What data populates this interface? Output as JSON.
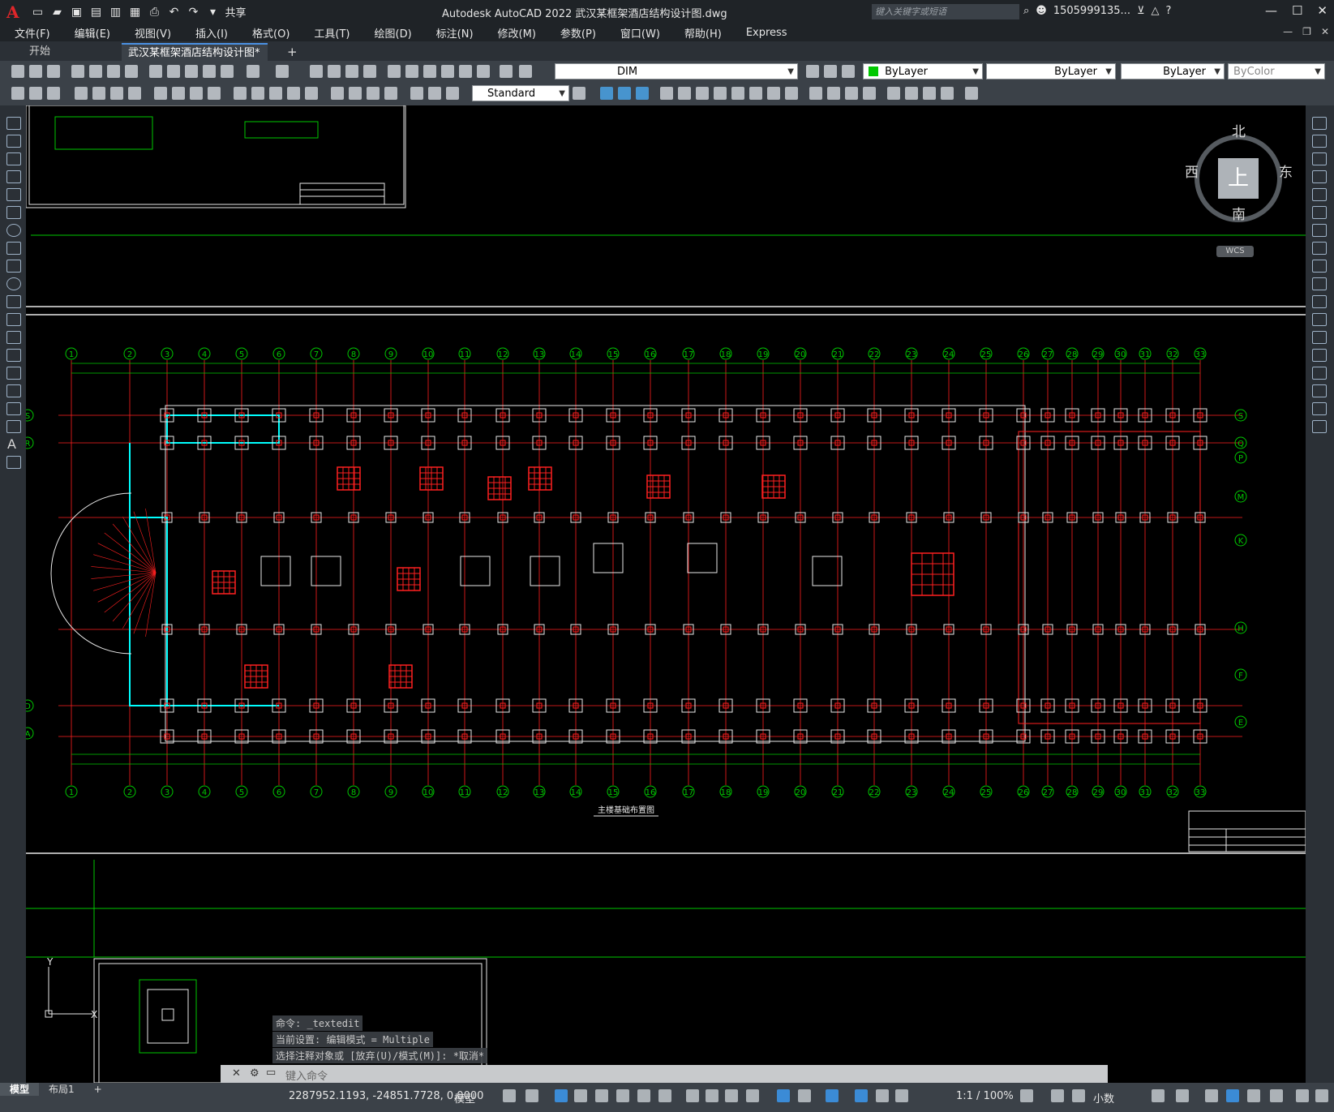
{
  "app": {
    "title": "Autodesk AutoCAD 2022    武汉某框架酒店结构设计图.dwg",
    "logo": "A",
    "share_label": "共享",
    "search_placeholder": "键入关键字或短语",
    "user": "1505999135..."
  },
  "menu": [
    "文件(F)",
    "编辑(E)",
    "视图(V)",
    "插入(I)",
    "格式(O)",
    "工具(T)",
    "绘图(D)",
    "标注(N)",
    "修改(M)",
    "参数(P)",
    "窗口(W)",
    "帮助(H)",
    "Express"
  ],
  "tabs": {
    "start": "开始",
    "doc": "武汉某框架酒店结构设计图*",
    "add": "+"
  },
  "toolbar": {
    "layer": "DIM",
    "color": "ByLayer",
    "linetype": "ByLayer",
    "lineweight": "ByLayer",
    "plotstyle": "ByColor",
    "textstyle": "Standard"
  },
  "viewcube": {
    "top": "上",
    "north": "北",
    "south": "南",
    "east": "东",
    "west": "西",
    "wcs": "WCS"
  },
  "drawing": {
    "axis_numbers": [
      "1",
      "2",
      "3",
      "4",
      "5",
      "6",
      "7",
      "8",
      "9",
      "10",
      "11",
      "12",
      "13",
      "14",
      "15",
      "16",
      "17",
      "18",
      "19",
      "20",
      "21",
      "22",
      "23",
      "24",
      "25",
      "26",
      "27",
      "28",
      "29",
      "30",
      "31",
      "32",
      "33"
    ],
    "row_labels_left": [
      "S",
      "R",
      "D",
      "A"
    ],
    "row_labels_right": [
      "S",
      "Q",
      "P",
      "M",
      "K",
      "H",
      "F",
      "E"
    ],
    "plan_title": "主楼基础布置图"
  },
  "command": {
    "line1": "命令: _textedit",
    "line2": "当前设置: 编辑模式 = Multiple",
    "line3": "选择注释对象或 [放弃(U)/模式(M)]: *取消*",
    "input_placeholder": "键入命令"
  },
  "status": {
    "layout_model": "模型",
    "layout1": "布局1",
    "add": "+",
    "coords": "2287952.1193, -24851.7728, 0.0000",
    "model": "模型",
    "scale": "1:1 / 100%",
    "units": "小数"
  },
  "colors": {
    "grid": "#00c800",
    "beam": "#ff2020",
    "cyan": "#00ffff",
    "bg": "#000000",
    "accent": "#3b8bd6"
  }
}
